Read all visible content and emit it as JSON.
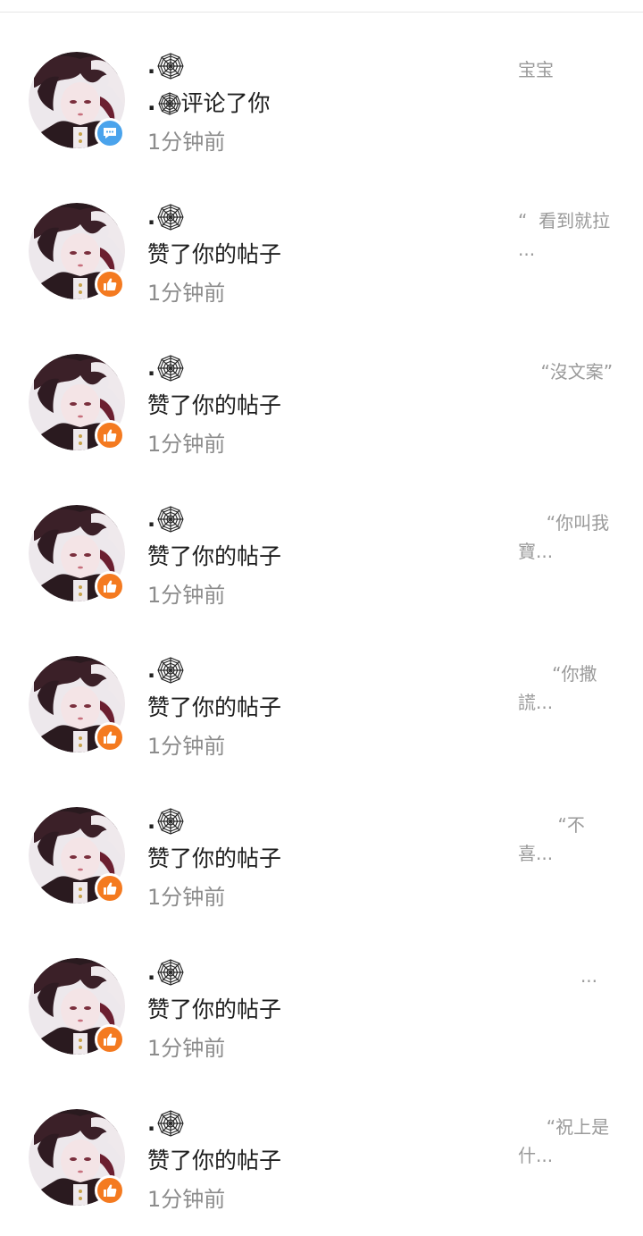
{
  "colors": {
    "comment_badge": "#4aa3ec",
    "like_badge": "#f47a20",
    "time_text": "#8c8c8c",
    "preview_text": "#9a9a9a"
  },
  "notifications": [
    {
      "name_prefix": ".",
      "name_icon": "spider-web-icon",
      "action_prefix": ".",
      "action_icon": "spider-web-icon",
      "action": "评论了你",
      "time": "1分钟前",
      "badge": "comment-icon",
      "preview": "宝宝"
    },
    {
      "name_prefix": ".",
      "name_icon": "spider-web-icon",
      "action": "赞了你的帖子",
      "time": "1分钟前",
      "badge": "thumbs-up-icon",
      "preview": "“  看到就拉  ..."
    },
    {
      "name_prefix": ".",
      "name_icon": "spider-web-icon",
      "action": "赞了你的帖子",
      "time": "1分钟前",
      "badge": "thumbs-up-icon",
      "preview": "    “沒文案”"
    },
    {
      "name_prefix": ".",
      "name_icon": "spider-web-icon",
      "action": "赞了你的帖子",
      "time": "1分钟前",
      "badge": "thumbs-up-icon",
      "preview": "     “你叫我寶..."
    },
    {
      "name_prefix": ".",
      "name_icon": "spider-web-icon",
      "action": "赞了你的帖子",
      "time": "1分钟前",
      "badge": "thumbs-up-icon",
      "preview": "      “你撒謊..."
    },
    {
      "name_prefix": ".",
      "name_icon": "spider-web-icon",
      "action": "赞了你的帖子",
      "time": "1分钟前",
      "badge": "thumbs-up-icon",
      "preview": "       “不喜..."
    },
    {
      "name_prefix": ".",
      "name_icon": "spider-web-icon",
      "action": "赞了你的帖子",
      "time": "1分钟前",
      "badge": "thumbs-up-icon",
      "preview": "           ..."
    },
    {
      "name_prefix": ".",
      "name_icon": "spider-web-icon",
      "action": "赞了你的帖子",
      "time": "1分钟前",
      "badge": "thumbs-up-icon",
      "preview": "     “祝上是什..."
    }
  ]
}
